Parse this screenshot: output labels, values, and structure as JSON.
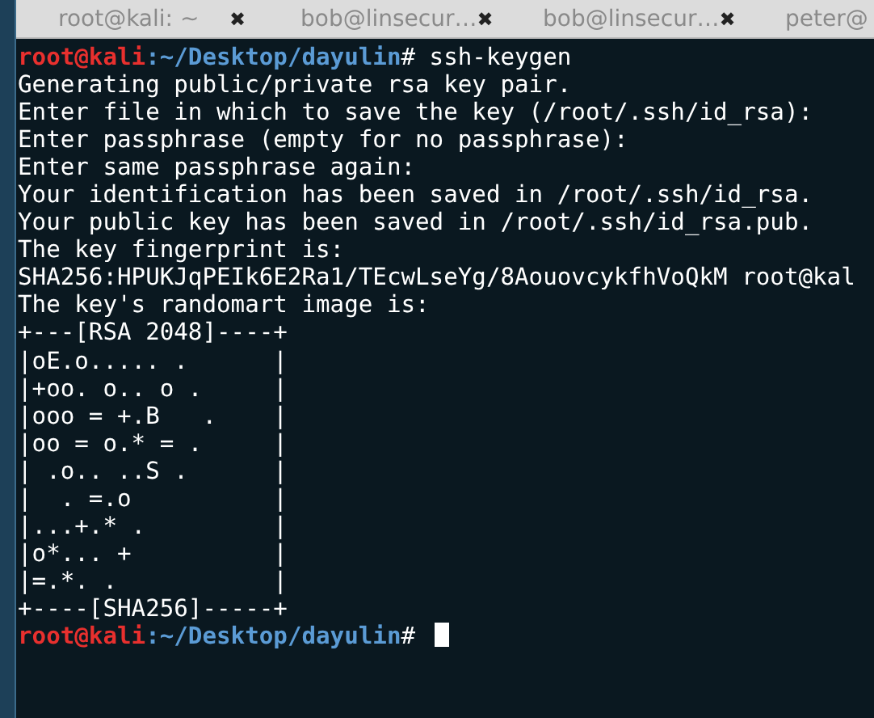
{
  "tabs": [
    {
      "title": "root@kali: ~",
      "close": "✖"
    },
    {
      "title": "bob@linsecur…",
      "close": "✖"
    },
    {
      "title": "bob@linsecur…",
      "close": "✖"
    },
    {
      "title": "peter@"
    }
  ],
  "lines": [
    {
      "kind": "prompt",
      "user": "root@kali",
      "path": ":~/Desktop/dayulin",
      "command": "# ssh-keygen"
    },
    {
      "kind": "output",
      "text": "Generating public/private rsa key pair."
    },
    {
      "kind": "output",
      "text": "Enter file in which to save the key (/root/.ssh/id_rsa):"
    },
    {
      "kind": "output",
      "text": "Enter passphrase (empty for no passphrase):"
    },
    {
      "kind": "output",
      "text": "Enter same passphrase again:"
    },
    {
      "kind": "output",
      "text": "Your identification has been saved in /root/.ssh/id_rsa."
    },
    {
      "kind": "output",
      "text": "Your public key has been saved in /root/.ssh/id_rsa.pub."
    },
    {
      "kind": "output",
      "text": "The key fingerprint is:"
    },
    {
      "kind": "output",
      "text": "SHA256:HPUKJqPEIk6E2Ra1/TEcwLseYg/8AouovcykfhVoQkM root@kal"
    },
    {
      "kind": "output",
      "text": "The key's randomart image is:"
    },
    {
      "kind": "output",
      "text": "+---[RSA 2048]----+"
    },
    {
      "kind": "output",
      "text": "|oE.o..... .      |"
    },
    {
      "kind": "output",
      "text": "|+oo. o.. o .     |"
    },
    {
      "kind": "output",
      "text": "|ooo = +.B   .    |"
    },
    {
      "kind": "output",
      "text": "|oo = o.* = .     |"
    },
    {
      "kind": "output",
      "text": "| .o.. ..S .      |"
    },
    {
      "kind": "output",
      "text": "|  . =.o          |"
    },
    {
      "kind": "output",
      "text": "|...+.* .         |"
    },
    {
      "kind": "output",
      "text": "|o*... +          |"
    },
    {
      "kind": "output",
      "text": "|=.*. .           |"
    },
    {
      "kind": "output",
      "text": "+----[SHA256]-----+"
    },
    {
      "kind": "prompt",
      "user": "root@kali",
      "path": ":~/Desktop/dayulin",
      "command": "#",
      "cursor": true
    }
  ]
}
